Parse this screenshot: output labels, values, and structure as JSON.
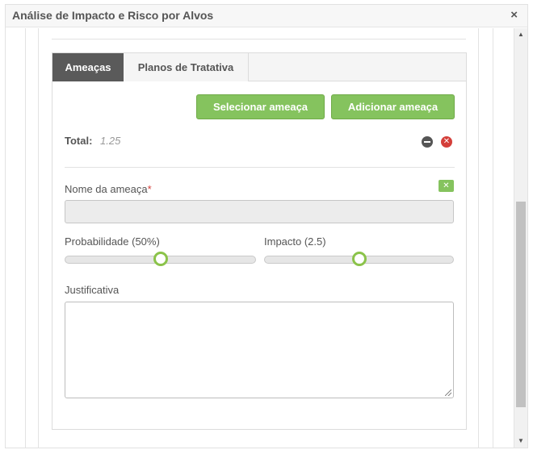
{
  "dialog": {
    "title": "Análise de Impacto e Risco por Alvos",
    "close_label": "×"
  },
  "tabs": [
    {
      "label": "Ameaças",
      "active": true
    },
    {
      "label": "Planos de Tratativa",
      "active": false
    }
  ],
  "actions": {
    "select_label": "Selecionar ameaça",
    "add_label": "Adicionar ameaça"
  },
  "total": {
    "label": "Total:",
    "value": "1.25"
  },
  "form": {
    "name_label": "Nome da ameaça",
    "required_mark": "*",
    "name_value": "",
    "probability": {
      "label": "Probabilidade (50%)",
      "value": 0.5
    },
    "impact": {
      "label": "Impacto (2.5)",
      "value": 0.5
    },
    "justification_label": "Justificativa",
    "justification_value": ""
  },
  "colors": {
    "accent_green": "#85c35e",
    "danger": "#d43f3a",
    "tab_active_bg": "#5a5a5a"
  },
  "icons": {
    "collapse": "minus-circle-icon",
    "remove": "remove-circle-icon",
    "clear": "close-icon"
  }
}
